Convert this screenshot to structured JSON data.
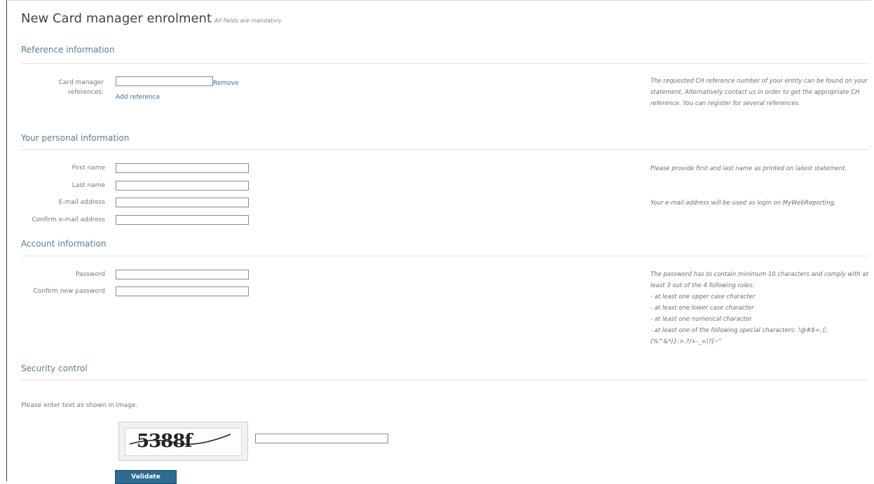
{
  "header": {
    "title": "New Card manager enrolment",
    "subtitle": "All fields are mandatory"
  },
  "reference": {
    "heading": "Reference information",
    "label": "Card manager references:",
    "value": "",
    "remove_link": "Remove",
    "add_link": "Add reference",
    "help": "The requested CH reference number of your entity can be found on your statement. Alternatively contact us in order to get the appropriate CH reference. You can register for several references."
  },
  "personal": {
    "heading": "Your personal information",
    "first_name_label": "First name",
    "last_name_label": "Last name",
    "email_label": "E-mail address",
    "confirm_email_label": "Confirm e-mail address",
    "help_name": "Please provide first and last name as printed on latest statement.",
    "help_email": "Your e-mail address will be used as login on MyWebReporting."
  },
  "account": {
    "heading": "Account information",
    "password_label": "Password",
    "confirm_password_label": "Confirm new password",
    "help_intro": "The password has to contain minimum 10 characters and comply with at least 3 out of the 4 following rules:",
    "rules": [
      "- at least one upper case character",
      "- at least one lower case character",
      "- at least one numerical character",
      "- at least one of the following special characters: !@#$=,{;(%^&*)}:>.?/+-_=|?[~\""
    ]
  },
  "security": {
    "heading": "Security control",
    "instruction": "Please enter text as shown in image.",
    "captcha_text": "5388f",
    "validate_label": "Validate"
  }
}
